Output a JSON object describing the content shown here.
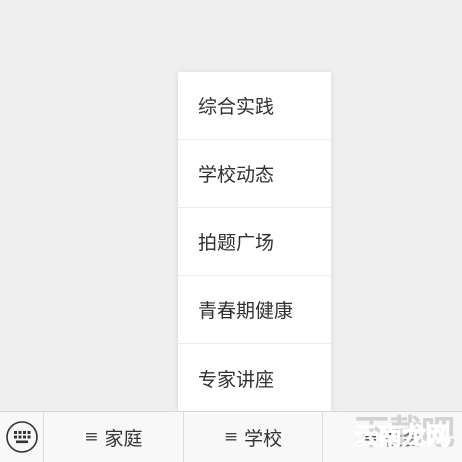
{
  "popup": {
    "items": [
      {
        "label": "综合实践"
      },
      {
        "label": "学校动态"
      },
      {
        "label": "拍题广场"
      },
      {
        "label": "青春期健康"
      },
      {
        "label": "专家讲座"
      }
    ]
  },
  "bottom_bar": {
    "keyboard_icon": "keyboard-icon",
    "menus": [
      {
        "icon": "≡",
        "label": "家庭"
      },
      {
        "icon": "≡",
        "label": "学校"
      },
      {
        "icon": "≡",
        "label": "社会"
      }
    ]
  },
  "watermark": {
    "back_text": "下载吧",
    "front_text": "云南龙网"
  },
  "colors": {
    "background": "#efefef",
    "popup_background": "#ffffff",
    "watermark_red": "#e04a1a"
  }
}
